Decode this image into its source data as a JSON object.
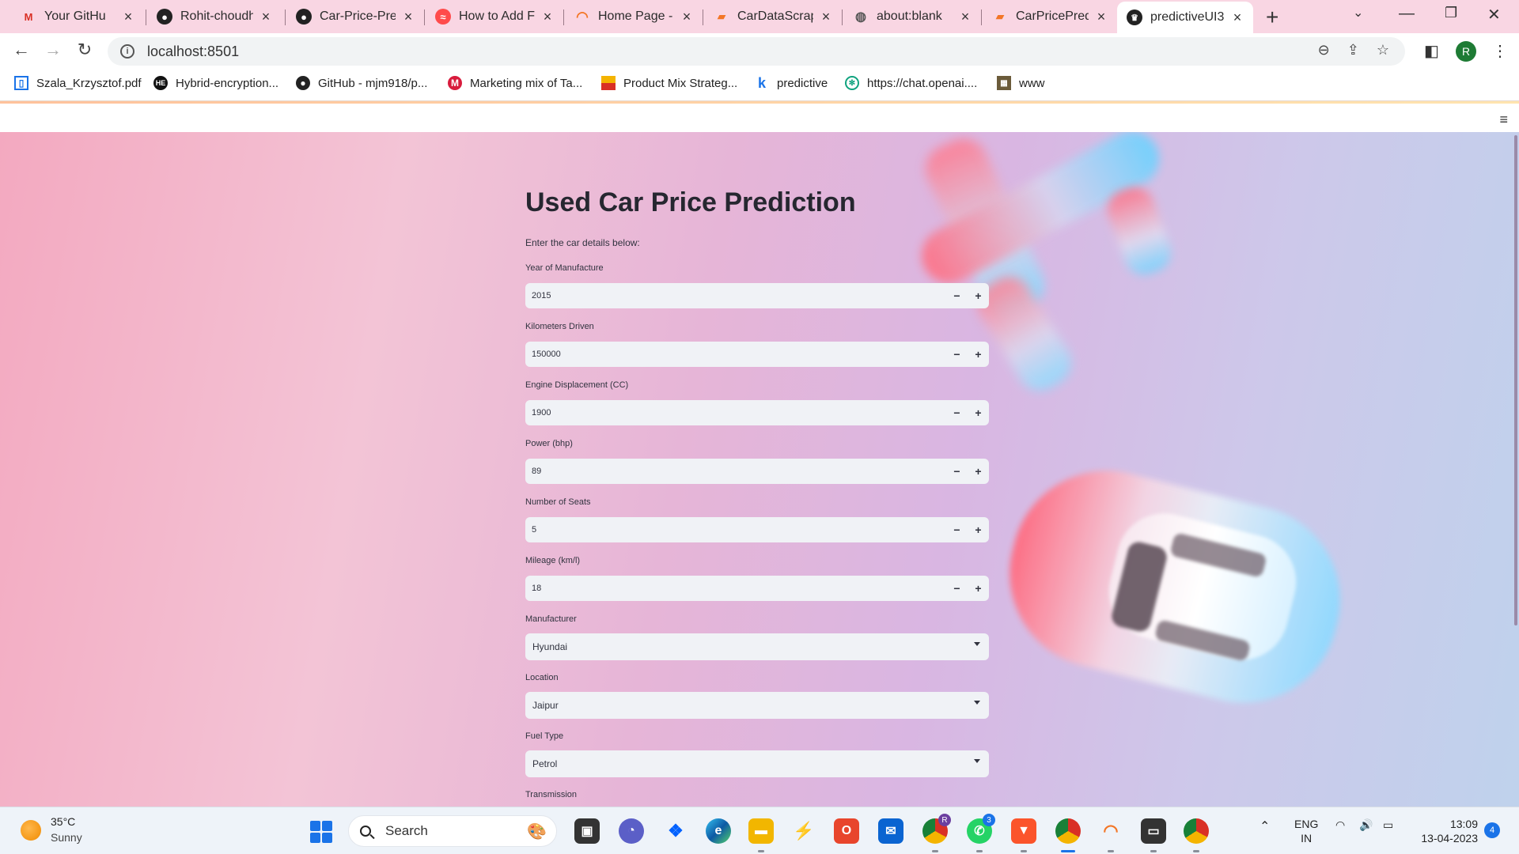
{
  "browser": {
    "tabs": [
      {
        "title": "Your GitHu",
        "icon": "gmail-icon"
      },
      {
        "title": "Rohit-choudh",
        "icon": "github-icon"
      },
      {
        "title": "Car-Price-Pred",
        "icon": "github-icon"
      },
      {
        "title": "How to Add F",
        "icon": "streamlit-forum-icon"
      },
      {
        "title": "Home Page - S",
        "icon": "jupyter-icon"
      },
      {
        "title": "CarDataScrap",
        "icon": "notebook-icon"
      },
      {
        "title": "about:blank",
        "icon": "globe-icon"
      },
      {
        "title": "CarPricePredi",
        "icon": "notebook-icon"
      },
      {
        "title": "predictiveUI3",
        "icon": "streamlit-icon"
      }
    ],
    "url": "localhost:8501",
    "profile_initial": "R",
    "bookmarks": [
      {
        "label": "Szala_Krzysztof.pdf",
        "icon": "document-icon"
      },
      {
        "label": "Hybrid-encryption...",
        "icon": "hybrid-icon"
      },
      {
        "label": "GitHub - mjm918/p...",
        "icon": "github-icon"
      },
      {
        "label": "Marketing mix of Ta...",
        "icon": "marketing-icon"
      },
      {
        "label": "Product Mix Strateg...",
        "icon": "product-icon"
      },
      {
        "label": "predictive",
        "icon": "k-icon"
      },
      {
        "label": "https://chat.openai....",
        "icon": "openai-icon"
      },
      {
        "label": "www",
        "icon": "www-icon"
      }
    ]
  },
  "app": {
    "title": "Used Car Price Prediction",
    "subtitle": "Enter the car details below:",
    "number_fields": [
      {
        "label": "Year of Manufacture",
        "value": "2015"
      },
      {
        "label": "Kilometers Driven",
        "value": "150000"
      },
      {
        "label": "Engine Displacement (CC)",
        "value": "1900"
      },
      {
        "label": "Power (bhp)",
        "value": "89"
      },
      {
        "label": "Number of Seats",
        "value": "5"
      },
      {
        "label": "Mileage (km/l)",
        "value": "18"
      }
    ],
    "select_fields": [
      {
        "label": "Manufacturer",
        "value": "Hyundai"
      },
      {
        "label": "Location",
        "value": "Jaipur"
      },
      {
        "label": "Fuel Type",
        "value": "Petrol"
      }
    ],
    "next_label": "Transmission",
    "step_minus": "−",
    "step_plus": "+"
  },
  "taskbar": {
    "weather_temp": "35°C",
    "weather_condition": "Sunny",
    "search_label": "Search",
    "whatsapp_badge": "3",
    "profile_badge": "R",
    "language": "ENG",
    "region": "IN",
    "time": "13:09",
    "date": "13-04-2023",
    "notification_count": "4"
  }
}
